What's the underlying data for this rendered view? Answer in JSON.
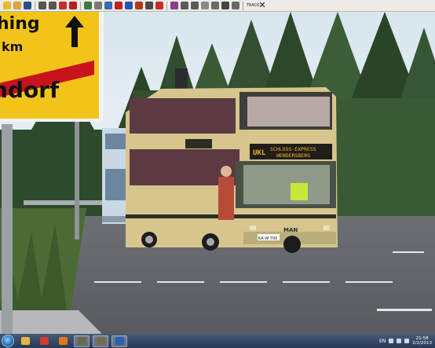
{
  "toolbar": {
    "icons": [
      {
        "name": "new-file-icon",
        "color": "#e8b830"
      },
      {
        "name": "open-folder-icon",
        "color": "#d9a441"
      },
      {
        "name": "save-icon",
        "color": "#2d4e8c"
      },
      {
        "name": "bus-icon",
        "color": "#555555"
      },
      {
        "name": "bus-alt-icon",
        "color": "#555555"
      },
      {
        "name": "bus-red-icon",
        "color": "#c03030"
      },
      {
        "name": "delete-icon",
        "color": "#b52020"
      },
      {
        "name": "map-icon",
        "color": "#3a7a3a"
      },
      {
        "name": "tools-icon",
        "color": "#7a7a7a"
      },
      {
        "name": "route-icon",
        "color": "#3a6ab0"
      },
      {
        "name": "warning-icon",
        "color": "#c02020"
      },
      {
        "name": "flag-icon",
        "color": "#2b55b5"
      },
      {
        "name": "spline-icon",
        "color": "#b03a20"
      },
      {
        "name": "object-icon",
        "color": "#4a4a4a"
      },
      {
        "name": "splines-icon",
        "color": "#cc2a2a"
      },
      {
        "name": "signals-icon",
        "color": "#8a3a8a"
      },
      {
        "name": "time-icon",
        "color": "#5a5a5a"
      },
      {
        "name": "camera-icon",
        "color": "#5a5a5a"
      },
      {
        "name": "weather-icon",
        "color": "#8a8a8a"
      },
      {
        "name": "grid-icon",
        "color": "#6a6a6a"
      },
      {
        "name": "track-icon",
        "color": "#444444"
      },
      {
        "name": "layers-icon",
        "color": "#6a6a6a"
      },
      {
        "name": "close-icon",
        "color": "#111111"
      }
    ],
    "track_label": "TRACK",
    "close_glyph": "✕"
  },
  "scene": {
    "sign_text_top": "hing",
    "sign_text_km": "km",
    "sign_text_bottom": "ndorf",
    "bus_route": "UKL",
    "bus_dest_line1": "SCHLOSS-EXPRESS",
    "bus_dest_line2": "WENDERSBERG",
    "bus_brand": "MAN",
    "bus_plate": "KA·W 700"
  },
  "taskbar": {
    "apps": [
      {
        "name": "windows-explorer-icon",
        "color": "#e3b64a"
      },
      {
        "name": "chrome-icon",
        "color": "#d33b2c"
      },
      {
        "name": "media-player-icon",
        "color": "#e07a1a"
      },
      {
        "name": "omsi-bus-app-icon",
        "color": "#6b6b4a"
      },
      {
        "name": "bus-app-icon",
        "color": "#7a6a4a"
      },
      {
        "name": "word-icon",
        "color": "#2b5eb5"
      }
    ],
    "lang": "EN",
    "time": "21:58",
    "date": "2/2/2013"
  }
}
